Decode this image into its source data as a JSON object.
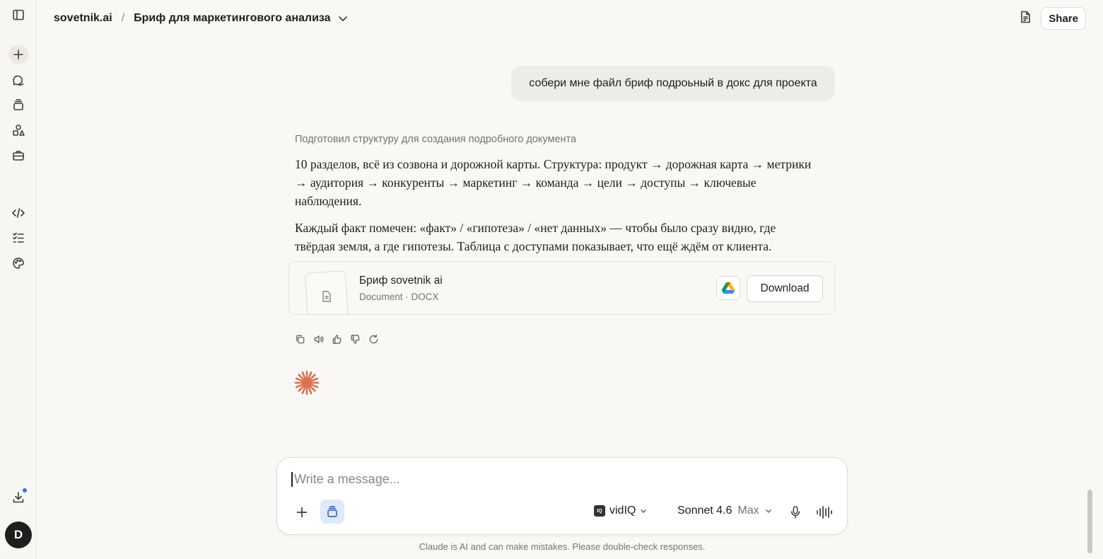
{
  "header": {
    "breadcrumb_root": "sovetnik.ai",
    "breadcrumb_sep": "/",
    "conversation_title": "Бриф для маркетингового анализа",
    "share_label": "Share"
  },
  "sidebar": {
    "items": [
      {
        "icon": "sidebar-toggle-icon"
      },
      {
        "icon": "new-chat-icon"
      },
      {
        "icon": "chats-icon"
      },
      {
        "icon": "projects-icon"
      },
      {
        "icon": "artifacts-icon"
      },
      {
        "icon": "toolbox-icon"
      },
      {
        "icon": "code-icon"
      },
      {
        "icon": "tasks-icon"
      },
      {
        "icon": "palette-icon"
      },
      {
        "icon": "download-app-icon"
      }
    ],
    "avatar_initial": "D"
  },
  "messages": {
    "user_text": "собери мне файл бриф подроьный в докс для проекта",
    "assistant_thought": "Подготовил структуру для создания подробного документа",
    "paragraph_1": "10 разделов, всё из созвона и дорожной карты. Структура: продукт → дорожная карта → метрики → аудитория → конкуренты → маркетинг → команда → цели → доступы → ключевые наблюдения.",
    "paragraph_2": "Каждый факт помечен: «факт» / «гипотеза» / «нет данных» — чтобы было сразу видно, где твёрдая земля, а где гипотезы. Таблица с доступами показывает, что ещё ждём от клиента.",
    "file": {
      "name": "Бриф sovetnik ai",
      "meta": "Document · DOCX",
      "download_label": "Download"
    }
  },
  "composer": {
    "placeholder": "Write a message...",
    "connector_label": "vidIQ",
    "model_name": "Sonnet 4.6",
    "model_mode": "Max"
  },
  "disclaimer": "Claude is AI and can make mistakes. Please double-check responses.",
  "colors": {
    "background": "#f9f8f5",
    "accent_spark": "#d9704f",
    "notification_dot": "#2f6ee5"
  }
}
